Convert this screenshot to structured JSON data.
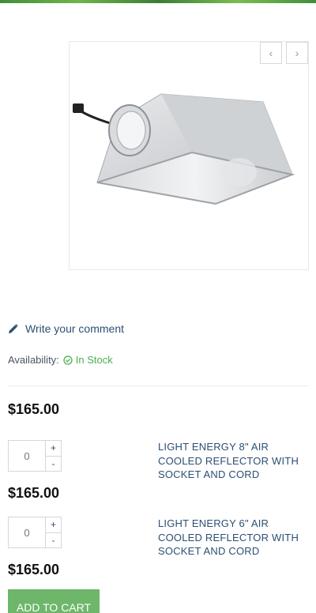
{
  "gallery": {
    "product_image": "reflector-product-image",
    "prev_icon": "‹",
    "next_icon": "›"
  },
  "comment": {
    "icon": "pencil-icon",
    "label": "Write your comment"
  },
  "availability": {
    "label": "Availability:",
    "status": "In Stock",
    "status_color": "#4caf50"
  },
  "main_price": "$165.00",
  "items": [
    {
      "qty": "0",
      "plus": "+",
      "minus": "-",
      "name": "LIGHT ENERGY 8\" AIR COOLED REFLECTOR WITH SOCKET AND CORD",
      "price": "$165.00"
    },
    {
      "qty": "0",
      "plus": "+",
      "minus": "-",
      "name": "LIGHT ENERGY 6\" AIR COOLED REFLECTOR WITH SOCKET AND CORD",
      "price": "$165.00"
    }
  ],
  "add_to_cart": "ADD TO CART",
  "colors": {
    "accent_green": "#6db66a",
    "link_blue": "#2d4f73"
  }
}
